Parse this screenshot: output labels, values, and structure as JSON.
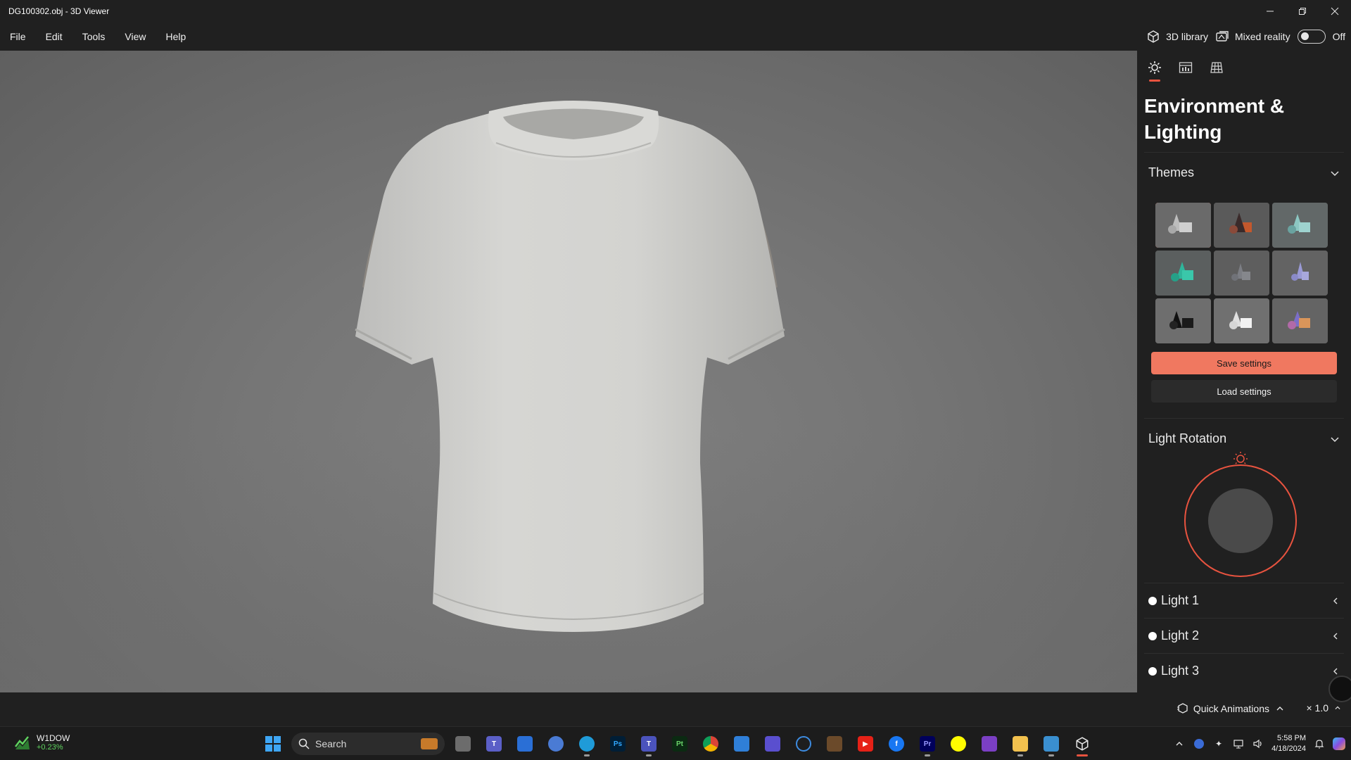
{
  "window": {
    "title": "DG100302.obj - 3D Viewer"
  },
  "menu": {
    "items": [
      "File",
      "Edit",
      "Tools",
      "View",
      "Help"
    ],
    "library_label": "3D library",
    "mixed_reality_label": "Mixed reality",
    "mixed_reality_state": "Off"
  },
  "panel": {
    "title": "Environment & Lighting",
    "themes_label": "Themes",
    "save_label": "Save settings",
    "load_label": "Load settings",
    "rotation_label": "Light Rotation",
    "lights": [
      "Light 1",
      "Light 2",
      "Light 3"
    ],
    "accent_color": "#e8533f"
  },
  "status": {
    "quick_animations_label": "Quick Animations",
    "speed_label": "× 1.0"
  },
  "taskbar": {
    "stock_symbol": "W1DOW",
    "stock_change": "+0.23%",
    "search_placeholder": "Search",
    "time": "5:58 PM",
    "date": "4/18/2024"
  }
}
